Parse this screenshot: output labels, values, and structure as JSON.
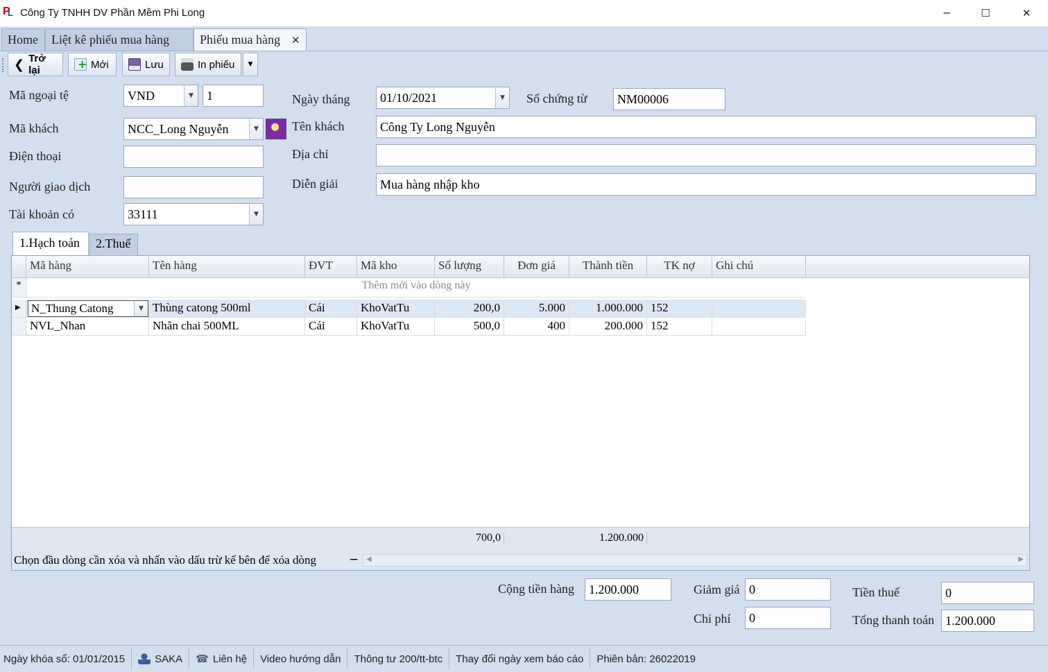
{
  "window": {
    "title": "Công Ty TNHH DV Phần Mềm Phi Long",
    "minimize": "─",
    "maximize": "☐",
    "close": "✕"
  },
  "tabs": [
    {
      "label": "Home"
    },
    {
      "label": "Liệt kê phiếu mua hàng"
    },
    {
      "label": "Phiếu mua hàng",
      "close": "✕"
    }
  ],
  "toolbar": {
    "back_label": "Trở lại",
    "new_label": "Mới",
    "save_label": "Lưu",
    "print_label": "In phiếu"
  },
  "form": {
    "currency_label": "Mã ngoại tệ",
    "currency_value": "VND",
    "rate_value": "1",
    "date_label": "Ngày tháng",
    "date_value": "01/10/2021",
    "voucher_no_label": "Số chứng từ",
    "voucher_no_value": "NM00006",
    "customer_code_label": "Mã khách",
    "customer_code_value": "NCC_Long Nguyễn",
    "customer_name_label": "Tên khách",
    "customer_name_value": "Công Ty Long Nguyễn",
    "phone_label": "Điện thoại",
    "phone_value": "",
    "address_label": "Địa chỉ",
    "address_value": "",
    "contact_label": "Người giao dịch",
    "contact_value": "",
    "description_label": "Diễn giải",
    "description_value": "Mua hàng nhập kho",
    "credit_account_label": "Tài khoản có",
    "credit_account_value": "33111"
  },
  "subtabs": [
    {
      "label": "1.Hạch toán"
    },
    {
      "label": "2.Thuế"
    }
  ],
  "grid": {
    "columns": [
      "Mã hàng",
      "Tên hàng",
      "ĐVT",
      "Mã kho",
      "Số lượng",
      "Đơn giá",
      "Thành tiền",
      "TK nợ",
      "Ghi chú"
    ],
    "new_row_marker": "*",
    "new_row_text": "Thêm mới vào dòng này",
    "rows": [
      {
        "ma_hang": "N_Thung Catong",
        "ten_hang": "Thùng catong 500ml",
        "dvt": "Cái",
        "ma_kho": "KhoVatTu",
        "so_luong": "200,0",
        "don_gia": "5.000",
        "thanh_tien": "1.000.000",
        "tk_no": "152",
        "ghi_chu": ""
      },
      {
        "ma_hang": "NVL_Nhan",
        "ten_hang": "Nhãn chai 500ML",
        "dvt": "Cái",
        "ma_kho": "KhoVatTu",
        "so_luong": "500,0",
        "don_gia": "400",
        "thanh_tien": "200.000",
        "tk_no": "152",
        "ghi_chu": ""
      }
    ],
    "footer_quantity": "700,0",
    "footer_amount": "1.200.000",
    "hint_text": "Chọn đầu dòng cần xóa và nhấn vào dấu trừ kế bên để xóa dòng",
    "delete_symbol": "−"
  },
  "totals": {
    "goods_label": "Cộng tiền hàng",
    "goods_value": "1.200.000",
    "discount_label": "Giảm giá",
    "discount_value": "0",
    "tax_label": "Tiền thuế",
    "tax_value": "0",
    "expense_label": "Chi phí",
    "expense_value": "0",
    "grand_total_label": "Tổng thanh toán",
    "grand_total_value": "1.200.000"
  },
  "statusbar": {
    "lock_date": "Ngày khóa sổ: 01/01/2015",
    "user": "SAKA",
    "contact": "Liên hệ",
    "video": "Video hướng dẫn",
    "circular": "Thông tư 200/tt-btc",
    "change_date": "Thay đổi ngày xem báo cáo",
    "version": "Phiên bản: 26022019"
  }
}
